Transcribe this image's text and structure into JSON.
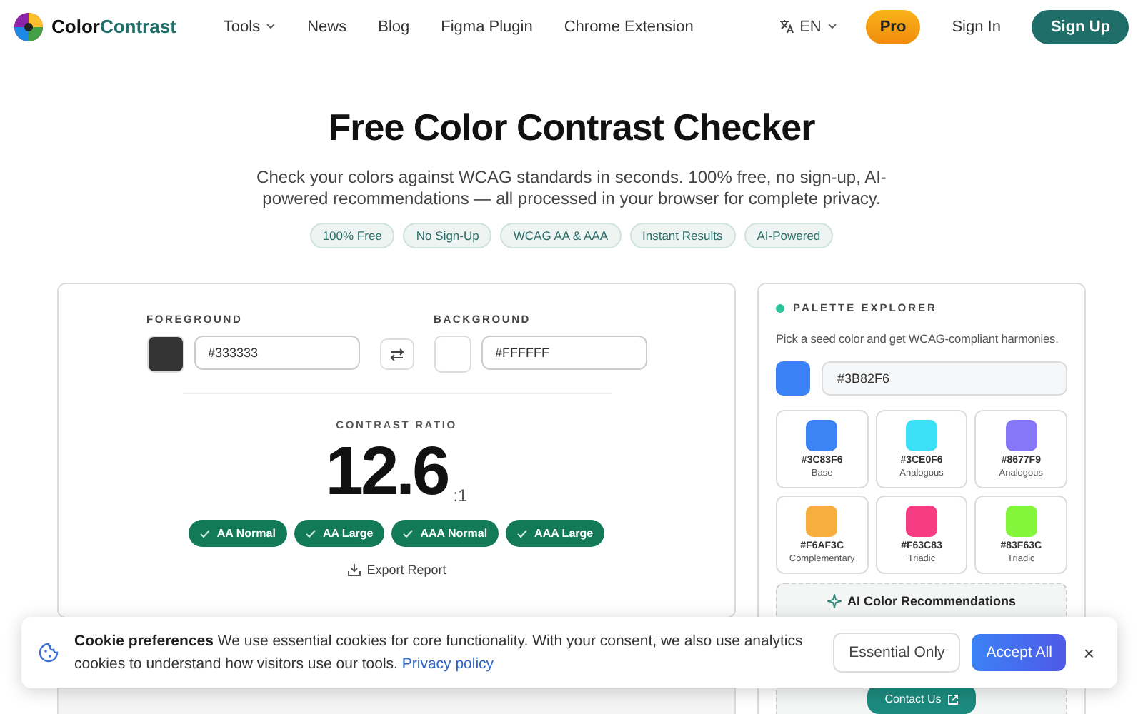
{
  "header": {
    "logo": {
      "first": "Color",
      "second": "Contrast"
    },
    "nav": [
      {
        "label": "Tools",
        "dropdown": true
      },
      {
        "label": "News",
        "dropdown": false
      },
      {
        "label": "Blog",
        "dropdown": false
      },
      {
        "label": "Figma Plugin",
        "dropdown": false
      },
      {
        "label": "Chrome Extension",
        "dropdown": false
      }
    ],
    "language": "EN",
    "pro": "Pro",
    "sign_in": "Sign In",
    "sign_up": "Sign Up"
  },
  "hero": {
    "title": "Free Color Contrast Checker",
    "subtitle": "Check your colors against WCAG standards in seconds. 100% free, no sign-up, AI-powered recommendations — all processed in your browser for complete privacy.",
    "badges": [
      "100% Free",
      "No Sign-Up",
      "WCAG AA & AAA",
      "Instant Results",
      "AI-Powered"
    ]
  },
  "checker": {
    "foreground": {
      "label": "FOREGROUND",
      "value": "#333333",
      "color": "#333333"
    },
    "background": {
      "label": "BACKGROUND",
      "value": "#FFFFFF",
      "color": "#ffffff"
    },
    "ratio_label": "CONTRAST RATIO",
    "ratio": "12.6",
    "ratio_suffix": ":1",
    "results": [
      {
        "label": "AA Normal",
        "pass": true
      },
      {
        "label": "AA Large",
        "pass": true
      },
      {
        "label": "AAA Normal",
        "pass": true
      },
      {
        "label": "AAA Large",
        "pass": true
      }
    ],
    "export": "Export Report"
  },
  "palette": {
    "title": "PALETTE EXPLORER",
    "description": "Pick a seed color and get WCAG-compliant harmonies.",
    "seed": {
      "value": "#3B82F6",
      "color": "#3b82f6"
    },
    "swatches": [
      {
        "hex": "#3C83F6",
        "role": "Base",
        "color": "#3c83f6"
      },
      {
        "hex": "#3CE0F6",
        "role": "Analogous",
        "color": "#3ce0f6"
      },
      {
        "hex": "#8677F9",
        "role": "Analogous",
        "color": "#8677f9"
      },
      {
        "hex": "#F6AF3C",
        "role": "Complementary",
        "color": "#f6af3c"
      },
      {
        "hex": "#F63C83",
        "role": "Triadic",
        "color": "#f63c83"
      },
      {
        "hex": "#83F63C",
        "role": "Triadic",
        "color": "#83f63c"
      }
    ],
    "ai_title": "AI Color Recommendations",
    "contact": "Contact Us"
  },
  "cookie_banner": {
    "title": "Cookie preferences",
    "text": "We use essential cookies for core functionality. With your consent, we also use analytics cookies to understand how visitors use our tools.",
    "link": "Privacy policy",
    "essential": "Essential Only",
    "accept": "Accept All",
    "close": "×"
  }
}
